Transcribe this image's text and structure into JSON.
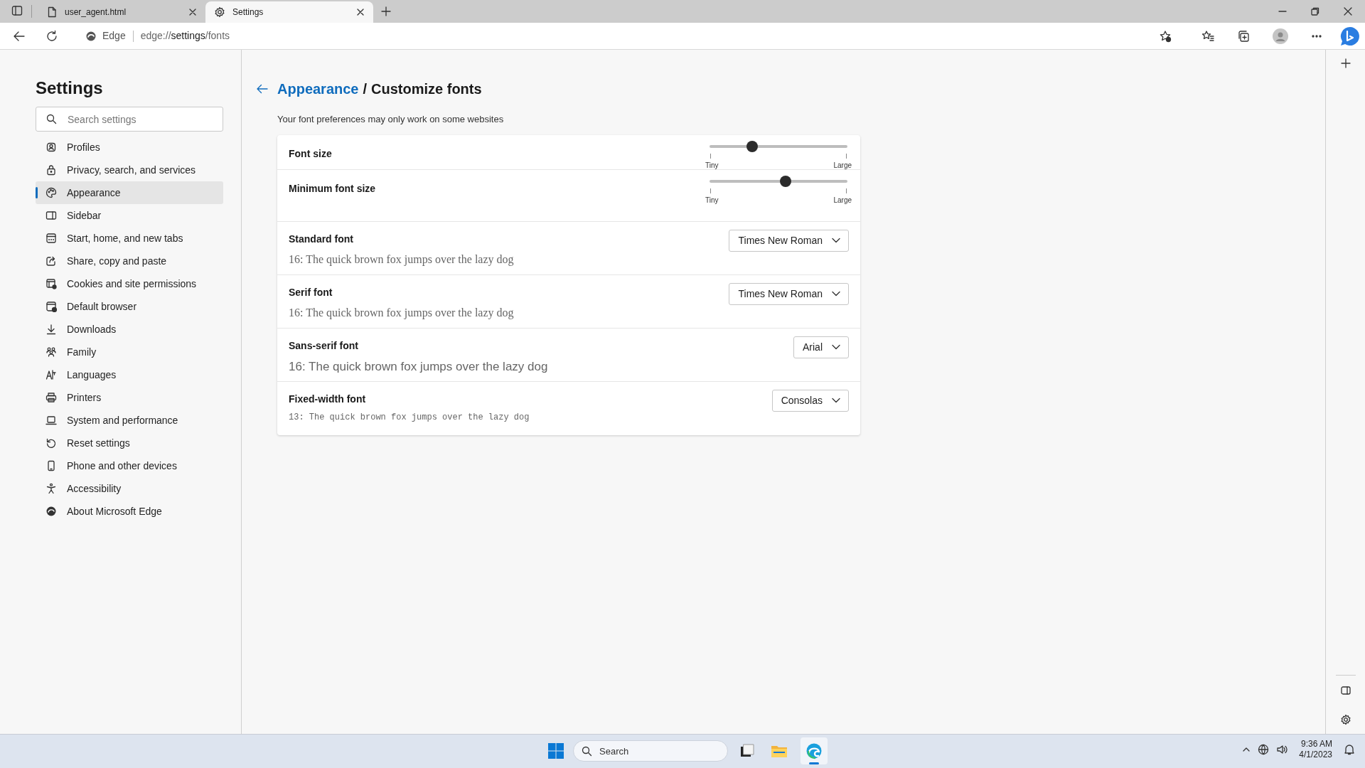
{
  "browser": {
    "tabs": [
      {
        "title": "user_agent.html",
        "selected": false
      },
      {
        "title": "Settings",
        "selected": true
      }
    ],
    "address_bar": {
      "site_label": "Edge",
      "url_prefix": "edge://",
      "url_host": "settings",
      "url_path": "/fonts"
    }
  },
  "sidebar": {
    "title": "Settings",
    "search": {
      "placeholder": "Search settings"
    },
    "items": [
      {
        "label": "Profiles",
        "selected": false
      },
      {
        "label": "Privacy, search, and services",
        "selected": false
      },
      {
        "label": "Appearance",
        "selected": true
      },
      {
        "label": "Sidebar",
        "selected": false
      },
      {
        "label": "Start, home, and new tabs",
        "selected": false
      },
      {
        "label": "Share, copy and paste",
        "selected": false
      },
      {
        "label": "Cookies and site permissions",
        "selected": false
      },
      {
        "label": "Default browser",
        "selected": false
      },
      {
        "label": "Downloads",
        "selected": false
      },
      {
        "label": "Family",
        "selected": false
      },
      {
        "label": "Languages",
        "selected": false
      },
      {
        "label": "Printers",
        "selected": false
      },
      {
        "label": "System and performance",
        "selected": false
      },
      {
        "label": "Reset settings",
        "selected": false
      },
      {
        "label": "Phone and other devices",
        "selected": false
      },
      {
        "label": "Accessibility",
        "selected": false
      },
      {
        "label": "About Microsoft Edge",
        "selected": false
      }
    ]
  },
  "page": {
    "breadcrumb": {
      "parent": "Appearance",
      "separator": "/",
      "current": "Customize fonts"
    },
    "subtitle": "Your font preferences may only work on some websites",
    "sliders": [
      {
        "label": "Font size",
        "level": 0.31,
        "min_label": "Tiny",
        "max_label": "Large"
      },
      {
        "label": "Minimum font size",
        "level": 0.55,
        "min_label": "Tiny",
        "max_label": "Large"
      }
    ],
    "fonts": [
      {
        "label": "Standard font",
        "value": "Times New Roman",
        "sample": "16: The quick brown fox jumps over the lazy dog",
        "kind": "serif"
      },
      {
        "label": "Serif font",
        "value": "Times New Roman",
        "sample": "16: The quick brown fox jumps over the lazy dog",
        "kind": "serif"
      },
      {
        "label": "Sans-serif font",
        "value": "Arial",
        "sample": "16: The quick brown fox jumps over the lazy dog",
        "kind": "sans"
      },
      {
        "label": "Fixed-width font",
        "value": "Consolas",
        "sample": "13: The quick brown fox jumps over the lazy dog",
        "kind": "mono"
      }
    ]
  },
  "taskbar": {
    "search": {
      "placeholder": "Search"
    },
    "time": "9:36 AM",
    "date": "4/1/2023"
  }
}
